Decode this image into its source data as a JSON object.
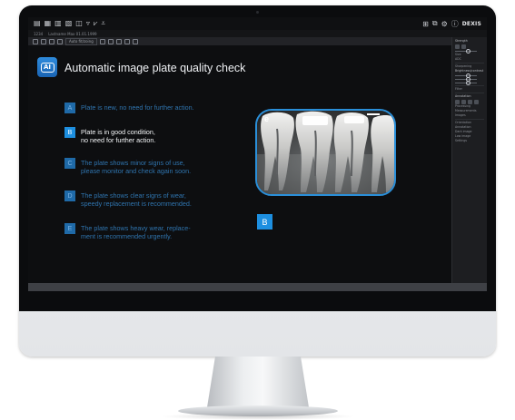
{
  "window": {
    "title_icons": [
      "open-icon",
      "print-icon",
      "grid-icon",
      "export-icon",
      "save-icon",
      "pen-icon",
      "measure-icon",
      "filter-icon"
    ],
    "right_icons": [
      "layout-icon",
      "compare-icon",
      "settings-icon",
      "info-icon"
    ],
    "brand": "DEXIS"
  },
  "infobar": {
    "id": "1234",
    "patient": "Lastname Max   01.01.1999"
  },
  "toolbar": {
    "zoom": "Auto fit/zoing"
  },
  "main": {
    "headline": "Automatic image plate quality check",
    "ai_label": "AI",
    "items": [
      {
        "letter": "A",
        "line1": "Plate is new, no need for further action.",
        "line2": "",
        "active": false
      },
      {
        "letter": "B",
        "line1": "Plate is in good condition,",
        "line2": "no need for further action.",
        "active": true
      },
      {
        "letter": "C",
        "line1": "The plate shows minor signs of use,",
        "line2": "please monitor and check again soon.",
        "active": false
      },
      {
        "letter": "D",
        "line1": "The plate shows clear signs of wear,",
        "line2": "speedy replacement is recommended.",
        "active": false
      },
      {
        "letter": "E",
        "line1": "The plate shows heavy wear, replace-",
        "line2": "ment is recommended urgently.",
        "active": false
      }
    ],
    "result_letter": "B",
    "xray_corner_mark": "e"
  },
  "panel": {
    "rows": [
      "Strength",
      "Size",
      "ADC",
      "Sharpening",
      "Brightness/contrast",
      "Filter",
      "Annotation",
      "Processing",
      "Measurements",
      "Images",
      "Orientation",
      "Annotation",
      "Dark image",
      "Low image",
      "Settings"
    ]
  },
  "colors": {
    "accent": "#1d8fe0",
    "muted_text": "#2f74ae",
    "background": "#0d0e10"
  }
}
